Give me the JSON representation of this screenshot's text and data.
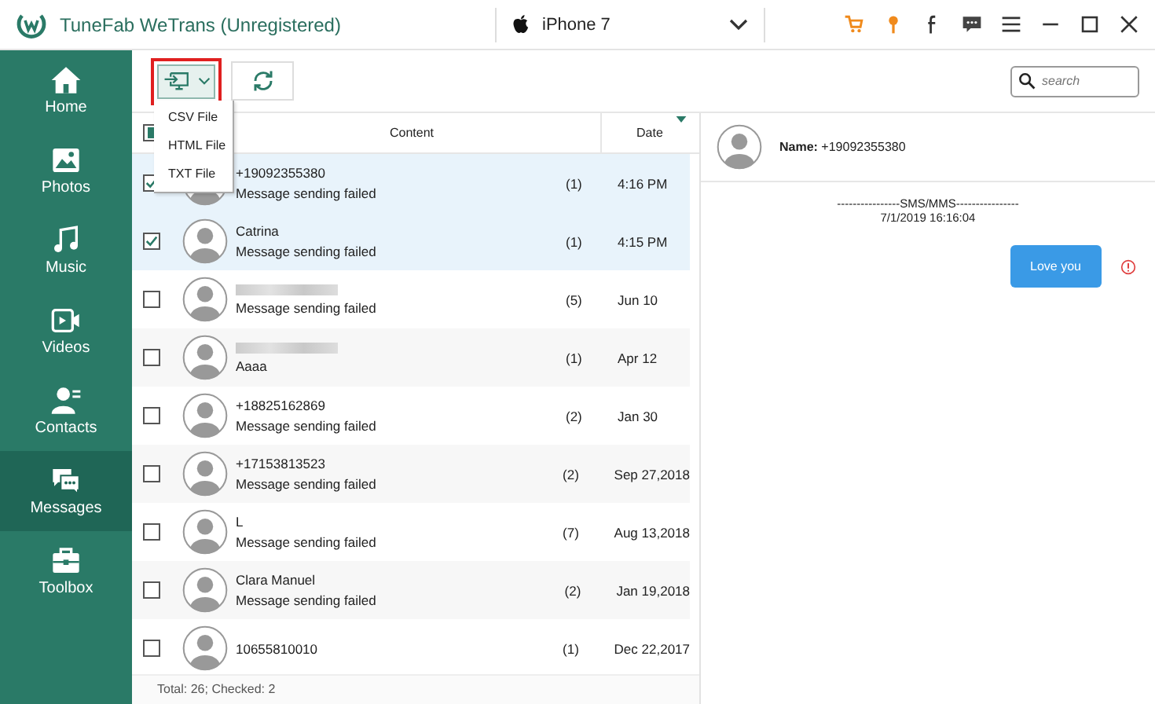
{
  "window": {
    "title": "TuneFab WeTrans (Unregistered)"
  },
  "device": {
    "name": "iPhone 7"
  },
  "sidebar": {
    "items": [
      {
        "label": "Home",
        "kind": "home",
        "selected": false
      },
      {
        "label": "Photos",
        "kind": "photo",
        "selected": false
      },
      {
        "label": "Music",
        "kind": "music",
        "selected": false
      },
      {
        "label": "Videos",
        "kind": "video",
        "selected": false
      },
      {
        "label": "Contacts",
        "kind": "contact",
        "selected": false
      },
      {
        "label": "Messages",
        "kind": "message",
        "selected": true
      },
      {
        "label": "Toolbox",
        "kind": "toolbox",
        "selected": false
      }
    ]
  },
  "toolbar": {
    "search": {
      "placeholder": "search"
    },
    "export_menu": {
      "items": [
        "CSV File",
        "HTML File",
        "TXT File"
      ]
    }
  },
  "table": {
    "select_all": {
      "indeterminate": true
    },
    "columns": [
      "Content",
      "Date"
    ],
    "rows": [
      {
        "name": "+19092355380",
        "name_hidden": false,
        "preview": "Message sending failed",
        "count": "(1)",
        "date": "4:16 PM",
        "checked": true,
        "selected": true
      },
      {
        "name": "Catrina",
        "name_hidden": false,
        "preview": "Message sending failed",
        "count": "(1)",
        "date": "4:15 PM",
        "checked": true,
        "selected": true
      },
      {
        "name_hidden": true,
        "preview": "Message sending failed",
        "count": "(5)",
        "date": "Jun 10",
        "checked": false,
        "selected": false
      },
      {
        "name_hidden": true,
        "preview": "Aaaa",
        "count": "(1)",
        "date": "Apr 12",
        "checked": false,
        "selected": false
      },
      {
        "name": "+18825162869",
        "name_hidden": false,
        "preview": "Message sending failed",
        "count": "(2)",
        "date": "Jan 30",
        "checked": false,
        "selected": false
      },
      {
        "name": "+17153813523",
        "name_hidden": false,
        "preview": "Message sending failed",
        "count": "(2)",
        "date": "Sep 27,2018",
        "checked": false,
        "selected": false
      },
      {
        "name": "L",
        "name_hidden": false,
        "preview": "Message sending failed",
        "count": "(7)",
        "date": "Aug 13,2018",
        "checked": false,
        "selected": false
      },
      {
        "name": "Clara Manuel",
        "name_hidden": false,
        "preview": "Message sending failed",
        "count": "(2)",
        "date": "Jan 19,2018",
        "checked": false,
        "selected": false
      },
      {
        "name": "10655810010",
        "name_hidden": false,
        "count": "(1)",
        "date": "Dec 22,2017",
        "checked": false,
        "selected": false
      }
    ]
  },
  "status_bar": "Total: 26; Checked: 2",
  "conversation": {
    "contact": "**Name:** +19092355380",
    "separator": "----------------SMS/MMS----------------",
    "timestamp": "7/1/2019 16:16:04",
    "messages": [
      {
        "text": "Love you",
        "failed": true
      }
    ]
  }
}
